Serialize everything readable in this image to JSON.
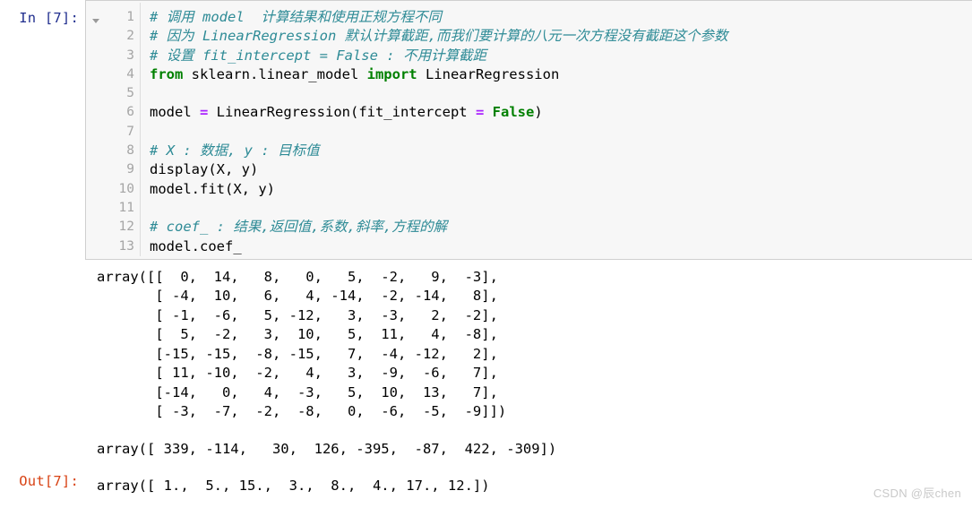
{
  "cell": {
    "input_prompt": "In [7]:",
    "output_prompt": "Out[7]:",
    "collapse_icon": "triangle-down-icon",
    "line_numbers": [
      "1",
      "2",
      "3",
      "4",
      "5",
      "6",
      "7",
      "8",
      "9",
      "10",
      "11",
      "12",
      "13"
    ],
    "code_lines": [
      {
        "n": "1",
        "segments": [
          {
            "type": "comment",
            "text": "# 调用 model  计算结果和使用正规方程不同"
          }
        ]
      },
      {
        "n": "2",
        "segments": [
          {
            "type": "comment",
            "text": "# 因为 LinearRegression 默认计算截距,而我们要计算的八元一次方程没有截距这个参数"
          }
        ]
      },
      {
        "n": "3",
        "segments": [
          {
            "type": "comment",
            "text": "# 设置 fit_intercept = False : 不用计算截距"
          }
        ]
      },
      {
        "n": "4",
        "segments": [
          {
            "type": "kw",
            "text": "from"
          },
          {
            "type": "plain",
            "text": " sklearn.linear_model "
          },
          {
            "type": "kw",
            "text": "import"
          },
          {
            "type": "plain",
            "text": " LinearRegression"
          }
        ]
      },
      {
        "n": "5",
        "segments": [
          {
            "type": "plain",
            "text": ""
          }
        ]
      },
      {
        "n": "6",
        "segments": [
          {
            "type": "plain",
            "text": "model "
          },
          {
            "type": "op",
            "text": "="
          },
          {
            "type": "plain",
            "text": " LinearRegression(fit_intercept "
          },
          {
            "type": "op",
            "text": "="
          },
          {
            "type": "plain",
            "text": " "
          },
          {
            "type": "kw",
            "text": "False"
          },
          {
            "type": "plain",
            "text": ")"
          }
        ]
      },
      {
        "n": "7",
        "segments": [
          {
            "type": "plain",
            "text": ""
          }
        ]
      },
      {
        "n": "8",
        "segments": [
          {
            "type": "comment",
            "text": "# X : 数据, y : 目标值"
          }
        ]
      },
      {
        "n": "9",
        "segments": [
          {
            "type": "plain",
            "text": "display(X, y)"
          }
        ]
      },
      {
        "n": "10",
        "segments": [
          {
            "type": "plain",
            "text": "model.fit(X, y)"
          }
        ]
      },
      {
        "n": "11",
        "segments": [
          {
            "type": "plain",
            "text": ""
          }
        ]
      },
      {
        "n": "12",
        "segments": [
          {
            "type": "comment",
            "text": "# coef_ : 结果,返回值,系数,斜率,方程的解"
          }
        ]
      },
      {
        "n": "13",
        "segments": [
          {
            "type": "plain",
            "text": "model.coef_"
          }
        ]
      }
    ]
  },
  "outputs": {
    "X_array_text": "array([[  0,  14,   8,   0,   5,  -2,   9,  -3],\n       [ -4,  10,   6,   4, -14,  -2, -14,   8],\n       [ -1,  -6,   5, -12,   3,  -3,   2,  -2],\n       [  5,  -2,   3,  10,   5,  11,   4,  -8],\n       [-15, -15,  -8, -15,   7,  -4, -12,   2],\n       [ 11, -10,  -2,   4,   3,  -9,  -6,   7],\n       [-14,   0,   4,  -3,   5,  10,  13,   7],\n       [ -3,  -7,  -2,  -8,   0,  -6,  -5,  -9]])",
    "y_array_text": "array([ 339, -114,   30,  126, -395,  -87,  422, -309])",
    "result_array_text": "array([ 1.,  5., 15.,  3.,  8.,  4., 17., 12.])",
    "X_matrix": [
      [
        0,
        14,
        8,
        0,
        5,
        -2,
        9,
        -3
      ],
      [
        -4,
        10,
        6,
        4,
        -14,
        -2,
        -14,
        8
      ],
      [
        -1,
        -6,
        5,
        -12,
        3,
        -3,
        2,
        -2
      ],
      [
        5,
        -2,
        3,
        10,
        5,
        11,
        4,
        -8
      ],
      [
        -15,
        -15,
        -8,
        -15,
        7,
        -4,
        -12,
        2
      ],
      [
        11,
        -10,
        -2,
        4,
        3,
        -9,
        -6,
        7
      ],
      [
        -14,
        0,
        4,
        -3,
        5,
        10,
        13,
        7
      ],
      [
        -3,
        -7,
        -2,
        -8,
        0,
        -6,
        -5,
        -9
      ]
    ],
    "y_vector": [
      339,
      -114,
      30,
      126,
      -395,
      -87,
      422,
      -309
    ],
    "coef_vector": [
      1.0,
      5.0,
      15.0,
      3.0,
      8.0,
      4.0,
      17.0,
      12.0
    ]
  },
  "watermark": {
    "text": "CSDN @辰chen"
  },
  "colors": {
    "prompt_in": "#22308f",
    "prompt_out": "#d84315",
    "comment": "#2e8b96",
    "keyword": "#008000",
    "operator": "#aa22ff",
    "cell_background": "#f7f7f7",
    "cell_border": "#cfcfcf",
    "gutter_text": "#a5a5a5"
  }
}
